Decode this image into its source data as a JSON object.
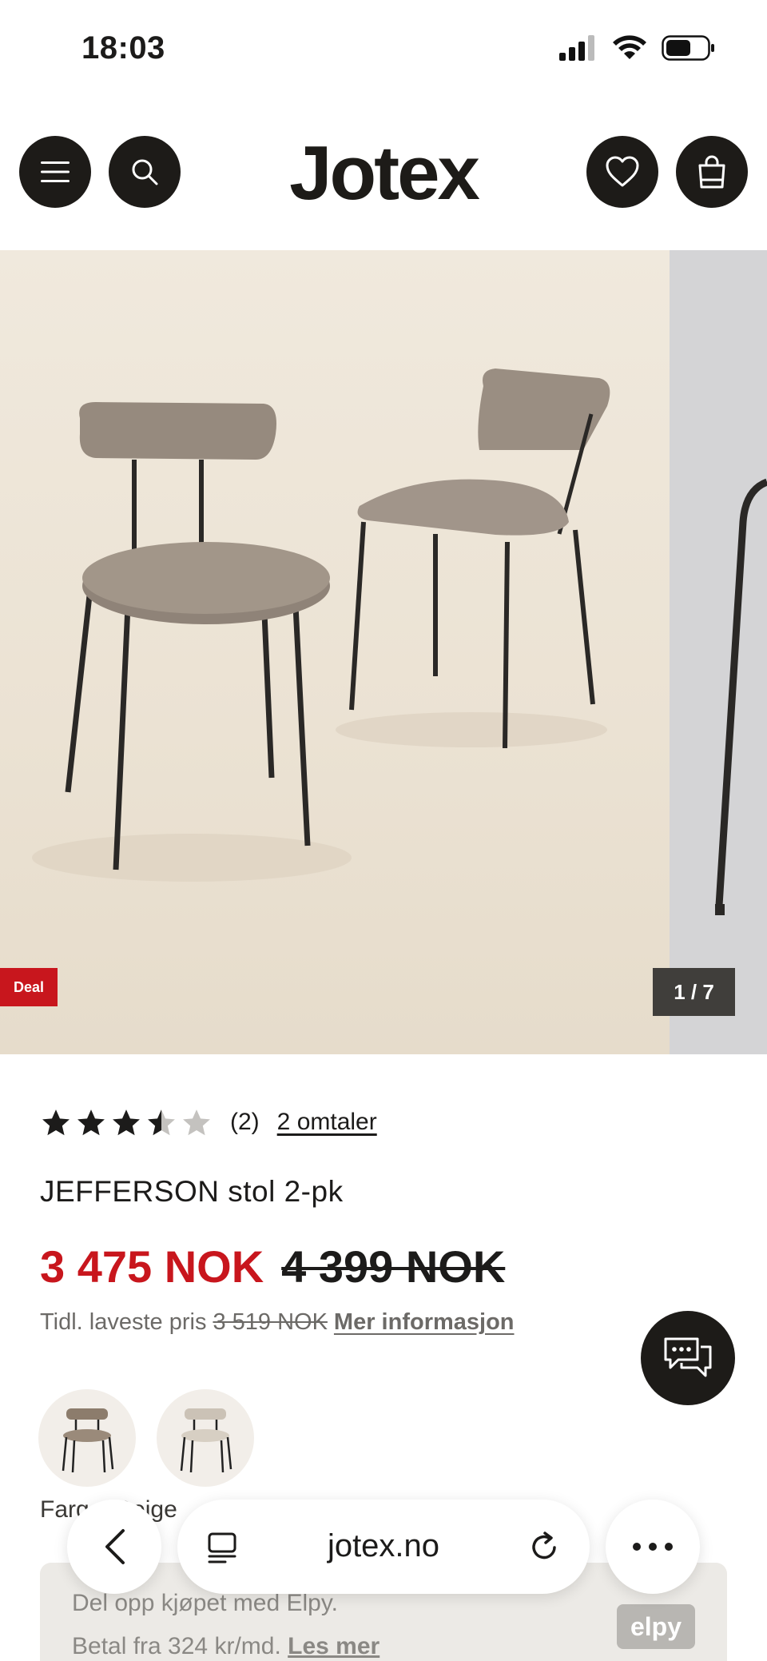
{
  "status_bar": {
    "time": "18:03"
  },
  "header": {
    "logo": "Jotex"
  },
  "gallery": {
    "badge": "Deal",
    "counter": "1 / 7"
  },
  "product": {
    "rating": 3.5,
    "rating_max": 5,
    "review_count_label": "(2)",
    "reviews_link": "2 omtaler",
    "name": "JEFFERSON stol 2-pk",
    "price_now": "3 475 NOK",
    "price_old": "4 399 NOK",
    "lowest_label": "Tidl. laveste pris",
    "lowest_price": "3 519 NOK",
    "more_info_link": "Mer informasjon",
    "color_label": "Farge: Beige"
  },
  "elpy": {
    "line1": "Del opp kjøpet med Elpy.",
    "line2_text": "Betal fra 324 kr/md.",
    "line2_link": "Les mer",
    "logo": "elpy"
  },
  "browser": {
    "url": "jotex.no"
  },
  "colors": {
    "accent_red": "#c8161d",
    "dark": "#1d1b18"
  }
}
